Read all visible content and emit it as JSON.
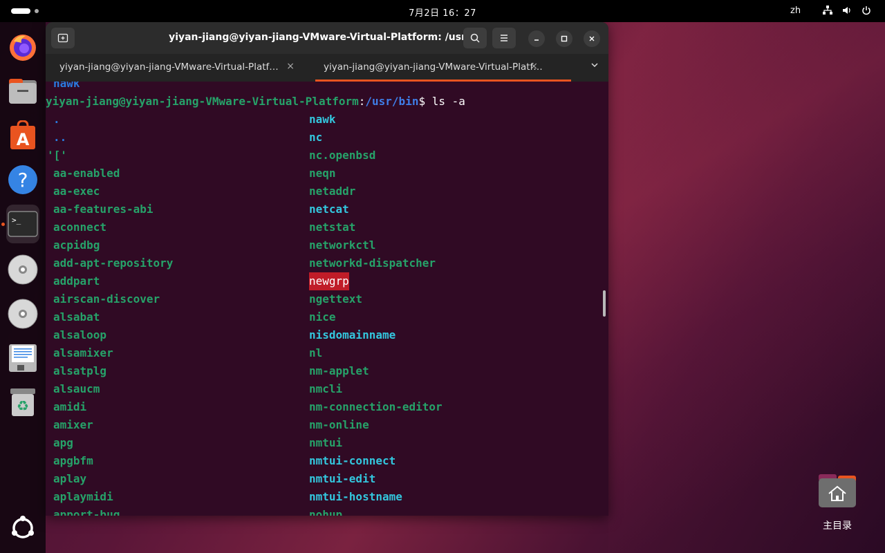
{
  "topbar": {
    "clock": "7月2日  16：27",
    "lang": "zh"
  },
  "dock": {
    "items": [
      "firefox-icon",
      "files-icon",
      "app-center-icon",
      "help-icon",
      "terminal-icon",
      "disc-icon",
      "disc-icon",
      "text-editor-icon",
      "trash-icon",
      "show-apps-icon"
    ]
  },
  "window": {
    "title": "yiyan-jiang@yiyan-jiang-VMware-Virtual-Platform: /usr/bin",
    "tabs": [
      {
        "label": "yiyan-jiang@yiyan-jiang-VMware-Virtual-Platf…",
        "close": "×"
      },
      {
        "label": "yiyan-jiang@yiyan-jiang-VMware-Virtual-Platf…",
        "close": "×"
      }
    ]
  },
  "terminal": {
    "partial_top": "nawk",
    "prompt_user": "yiyan-jiang@yiyan-jiang-VMware-Virtual-Platform",
    "prompt_colon": ":",
    "prompt_path": "/usr/bin",
    "prompt_dollar": "$ ",
    "command": "ls -a",
    "col1": [
      ".",
      "..",
      "'['",
      "aa-enabled",
      "aa-exec",
      "aa-features-abi",
      "aconnect",
      "acpidbg",
      "add-apt-repository",
      "addpart",
      "airscan-discover",
      "alsabat",
      "alsaloop",
      "alsamixer",
      "alsatplg",
      "alsaucm",
      "amidi",
      "amixer",
      "apg",
      "apgbfm",
      "aplay",
      "aplaymidi",
      "apport-bug"
    ],
    "col2": [
      "nawk",
      "nc",
      "nc.openbsd",
      "neqn",
      "netaddr",
      "netcat",
      "netstat",
      "networkctl",
      "networkd-dispatcher",
      "newgrp",
      "ngettext",
      "nice",
      "nisdomainname",
      "nl",
      "nm-applet",
      "nmcli",
      "nm-connection-editor",
      "nm-online",
      "nmtui",
      "nmtui-connect",
      "nmtui-edit",
      "nmtui-hostname",
      "nohup"
    ]
  },
  "desktop": {
    "home_label": "主目录"
  }
}
